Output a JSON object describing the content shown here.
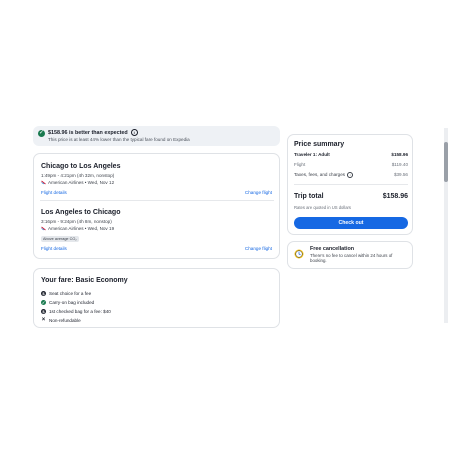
{
  "banner": {
    "headline": "$158.96 is better than expected",
    "subtext": "This price is at least 44% lower than the typical fare found on Expedia"
  },
  "flights": [
    {
      "title": "Chicago to Los Angeles",
      "times": "1:49pm - 4:21pm (4h 32m, nonstop)",
      "airline": "American Airlines • Wed, Nov 12",
      "details_link": "Flight details",
      "change_link": "Change flight"
    },
    {
      "title": "Los Angeles to Chicago",
      "times": "3:16pm - 9:24pm (4h 8m, nonstop)",
      "airline": "American Airlines • Wed, Nov 19",
      "badge": "Above average CO₂",
      "details_link": "Flight details",
      "change_link": "Change flight"
    }
  ],
  "fare": {
    "title": "Your fare: Basic Economy",
    "features": [
      {
        "icon": "dollar-icon",
        "text": "Seat choice for a fee"
      },
      {
        "icon": "check-icon",
        "text": "Carry-on bag included"
      },
      {
        "icon": "dollar-icon",
        "text": "1st checked bag for a fee: $40"
      },
      {
        "icon": "x-icon",
        "text": "Non-refundable"
      }
    ]
  },
  "price_summary": {
    "title": "Price summary",
    "traveler_label": "Traveler 1: Adult",
    "traveler_value": "$158.96",
    "flight_label": "Flight",
    "flight_value": "$119.40",
    "taxes_label": "Taxes, fees, and charges",
    "taxes_value": "$39.56",
    "total_label": "Trip total",
    "total_value": "$158.96",
    "currency_note": "Rates are quoted in US dollars",
    "checkout_label": "Check out"
  },
  "cancellation": {
    "title": "Free cancellation",
    "text": "There's no fee to cancel within 24 hours of booking."
  },
  "colors": {
    "accent": "#1668e3",
    "success": "#18794e",
    "banner_bg": "#eef1f5",
    "clock_yellow": "#f5c518"
  }
}
